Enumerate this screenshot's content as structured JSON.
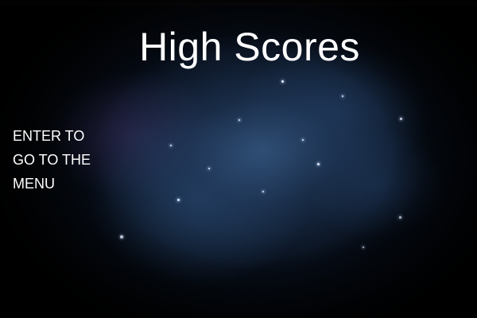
{
  "screen": {
    "title": "High Scores",
    "menu_hint_lines": [
      "ENTER TO",
      "GO TO THE",
      "MENU"
    ]
  },
  "colors": {
    "background": "#000000",
    "nebula_blue": "#345680",
    "nebula_purple": "#46346e",
    "text": "#ffffff"
  },
  "decor": {
    "background_name": "starfield-nebula"
  }
}
